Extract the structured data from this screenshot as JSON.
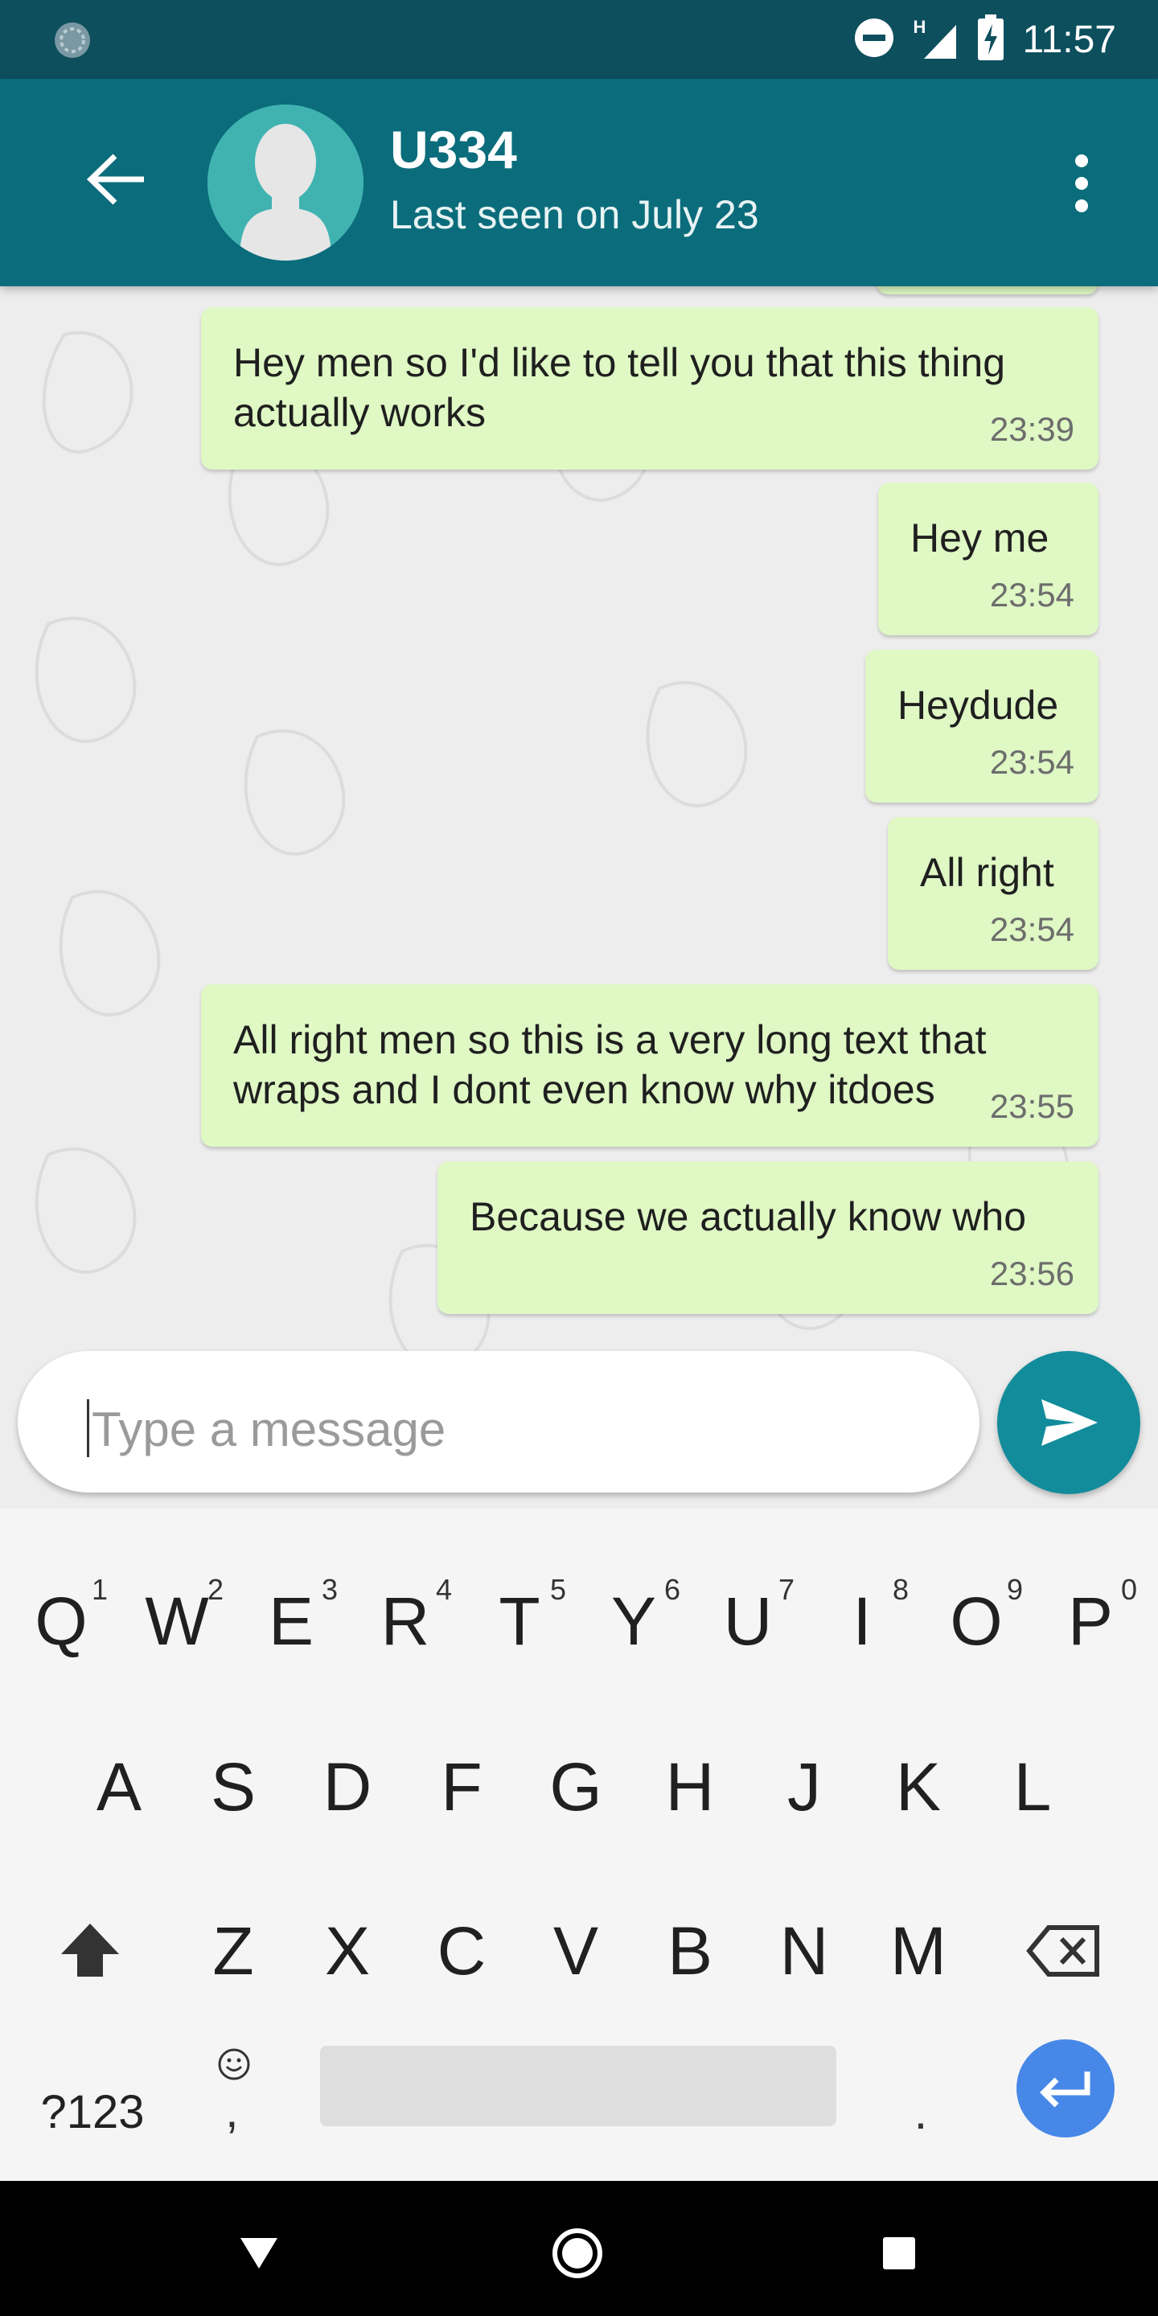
{
  "status_bar": {
    "time": "11:57",
    "network_label": "H"
  },
  "header": {
    "contact_name": "U334",
    "last_seen": "Last seen on July 23"
  },
  "messages": [
    {
      "text": "Hey men so I'd like to tell you that this thing\nactually works",
      "time": "23:39"
    },
    {
      "text": "Hey me",
      "time": "23:54"
    },
    {
      "text": "Heydude",
      "time": "23:54"
    },
    {
      "text": "All right",
      "time": "23:54"
    },
    {
      "text": "All right men so this is a very long text that\nwraps and I dont even know why itdoes",
      "time": "23:55"
    },
    {
      "text": "Because we actually know who",
      "time": "23:56"
    }
  ],
  "composer": {
    "placeholder": "Type a message",
    "value": ""
  },
  "keyboard": {
    "row1": [
      {
        "key": "Q",
        "hint": "1"
      },
      {
        "key": "W",
        "hint": "2"
      },
      {
        "key": "E",
        "hint": "3"
      },
      {
        "key": "R",
        "hint": "4"
      },
      {
        "key": "T",
        "hint": "5"
      },
      {
        "key": "Y",
        "hint": "6"
      },
      {
        "key": "U",
        "hint": "7"
      },
      {
        "key": "I",
        "hint": "8"
      },
      {
        "key": "O",
        "hint": "9"
      },
      {
        "key": "P",
        "hint": "0"
      }
    ],
    "row2": [
      "A",
      "S",
      "D",
      "F",
      "G",
      "H",
      "J",
      "K",
      "L"
    ],
    "row3": [
      "Z",
      "X",
      "C",
      "V",
      "B",
      "N",
      "M"
    ],
    "symbols_label": "?123",
    "comma_label": ",",
    "period_label": ".",
    "accent_color": "#4787e8"
  },
  "colors": {
    "status_bar": "#0d4f5d",
    "header": "#0b6c7b",
    "bubble": "#dff8c4",
    "send_button": "#128c9b"
  }
}
